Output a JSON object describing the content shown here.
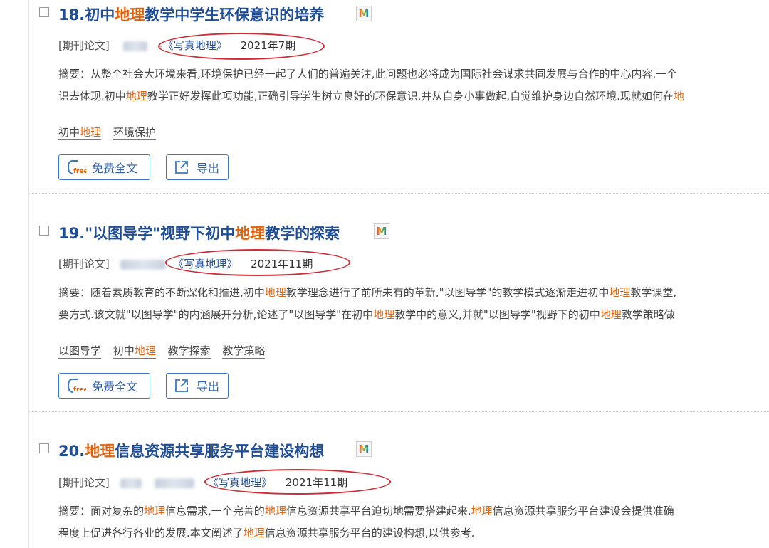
{
  "results": [
    {
      "number": "18.",
      "title_parts": [
        {
          "text": "初中",
          "hl": false
        },
        {
          "text": "地理",
          "hl": true
        },
        {
          "text": "教学中学生环保意识的培养",
          "hl": false
        }
      ],
      "type_label": "[期刊论文]",
      "separator": "-",
      "journal": "《写真地理》",
      "date": "2021年7期",
      "abstract_lines": [
        [
          {
            "text": "摘要：从整个社会大环境来看,环境保护已经一起了人们的普遍关注,此问题也必将成为国际社会谋求共同发展与合作的中心内容.一个",
            "hl": false
          }
        ],
        [
          {
            "text": "识去体现.初中",
            "hl": false
          },
          {
            "text": "地理",
            "hl": true
          },
          {
            "text": "教学正好发挥此项功能,正确引导学生树立良好的环保意识,并从自身小事做起,自觉维护身边自然环境.现就如何在",
            "hl": false
          },
          {
            "text": "地",
            "hl": true
          }
        ]
      ],
      "keywords": [
        [
          {
            "text": "初中",
            "hl": false
          },
          {
            "text": "地理",
            "hl": true
          }
        ],
        [
          {
            "text": "环境保护",
            "hl": false
          }
        ]
      ],
      "free_label": "免费全文",
      "export_label": "导出"
    },
    {
      "number": "19.",
      "title_parts": [
        {
          "text": "\"以图导学\"视野下初中",
          "hl": false
        },
        {
          "text": "地理",
          "hl": true
        },
        {
          "text": "教学的探索",
          "hl": false
        }
      ],
      "type_label": "[期刊论文]",
      "separator": "",
      "journal": "《写真地理》",
      "date": "2021年11期",
      "abstract_lines": [
        [
          {
            "text": "摘要：随着素质教育的不断深化和推进,初中",
            "hl": false
          },
          {
            "text": "地理",
            "hl": true
          },
          {
            "text": "教学理念进行了前所未有的革新,\"以图导学\"的教学模式逐渐走进初中",
            "hl": false
          },
          {
            "text": "地理",
            "hl": true
          },
          {
            "text": "教学课堂,",
            "hl": false
          }
        ],
        [
          {
            "text": "要方式.该文就\"以图导学\"的内涵展开分析,论述了\"以图导学\"在初中",
            "hl": false
          },
          {
            "text": "地理",
            "hl": true
          },
          {
            "text": "教学中的意义,并就\"以图导学\"视野下的初中",
            "hl": false
          },
          {
            "text": "地理",
            "hl": true
          },
          {
            "text": "教学策略做",
            "hl": false
          }
        ]
      ],
      "keywords": [
        [
          {
            "text": "以图导学",
            "hl": false
          }
        ],
        [
          {
            "text": "初中",
            "hl": false
          },
          {
            "text": "地理",
            "hl": true
          }
        ],
        [
          {
            "text": "教学探索",
            "hl": false
          }
        ],
        [
          {
            "text": "教学策略",
            "hl": false
          }
        ]
      ],
      "free_label": "免费全文",
      "export_label": "导出"
    },
    {
      "number": "20.",
      "title_parts": [
        {
          "text": "地理",
          "hl": true
        },
        {
          "text": "信息资源共享服务平台建设构想",
          "hl": false
        }
      ],
      "type_label": "[期刊论文]",
      "separator": "",
      "journal": "《写真地理》",
      "date": "2021年11期",
      "abstract_lines": [
        [
          {
            "text": "摘要：面对复杂的",
            "hl": false
          },
          {
            "text": "地理",
            "hl": true
          },
          {
            "text": "信息需求,一个完善的",
            "hl": false
          },
          {
            "text": "地理",
            "hl": true
          },
          {
            "text": "信息资源共享平台迫切地需要搭建起来.",
            "hl": false
          },
          {
            "text": "地理",
            "hl": true
          },
          {
            "text": "信息资源共享服务平台建设会提供准确",
            "hl": false
          }
        ],
        [
          {
            "text": "程度上促进各行各业的发展.本文阐述了",
            "hl": false
          },
          {
            "text": "地理",
            "hl": true
          },
          {
            "text": "信息资源共享服务平台的建设构想,以供参考.",
            "hl": false
          }
        ]
      ],
      "keywords": [],
      "free_label": "",
      "export_label": ""
    }
  ],
  "icons": {
    "format_badge": "M",
    "free_badge": "free"
  },
  "colors": {
    "title": "#1f4e96",
    "highlight": "#e0620d",
    "annotation_circle": "#d12a36",
    "button_border": "#3b78c8"
  }
}
